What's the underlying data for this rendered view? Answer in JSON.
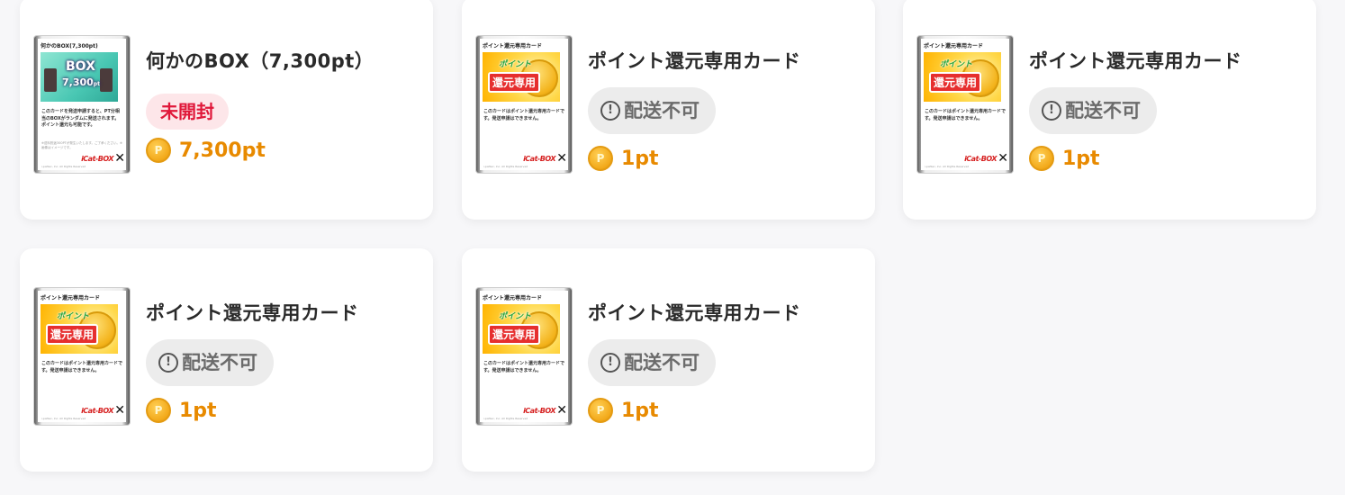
{
  "items": [
    {
      "name": "何かのBOX（7,300pt）",
      "status": "未開封",
      "status_type": "unopened",
      "points": "7,300pt",
      "card": {
        "header": "何かのBOX(7,300pt)",
        "art_line1": "BOX",
        "art_line2": "7,300",
        "art_line2_suffix": "pt",
        "desc": "このカードを発送申請すると、PT分相当のBOXがランダムに発送されます。ポイント還元も可能です。",
        "note": "※送料別途300PTが発生いたします。ご了承ください。※画像はイメージです。",
        "logo": "iCat-BOX",
        "copyright": "i-palSec, Inc. All Rights Reserved"
      }
    },
    {
      "name": "ポイント還元専用カード",
      "status": "配送不可",
      "status_type": "no-delivery",
      "points": "1pt",
      "card": {
        "header": "ポイント還元専用カード",
        "art_line1": "ポイント",
        "art_line2": "還元専用",
        "desc": "このカードはポイント還元専用カードです。発送申請はできません。",
        "logo": "iCat-BOX",
        "copyright": "i-palSec, Inc. All Rights Reserved"
      }
    },
    {
      "name": "ポイント還元専用カード",
      "status": "配送不可",
      "status_type": "no-delivery",
      "points": "1pt",
      "card": {
        "header": "ポイント還元専用カード",
        "art_line1": "ポイント",
        "art_line2": "還元専用",
        "desc": "このカードはポイント還元専用カードです。発送申請はできません。",
        "logo": "iCat-BOX",
        "copyright": "i-palSec, Inc. All Rights Reserved"
      }
    },
    {
      "name": "ポイント還元専用カード",
      "status": "配送不可",
      "status_type": "no-delivery",
      "points": "1pt",
      "card": {
        "header": "ポイント還元専用カード",
        "art_line1": "ポイント",
        "art_line2": "還元専用",
        "desc": "このカードはポイント還元専用カードです。発送申請はできません。",
        "logo": "iCat-BOX",
        "copyright": "i-palSec, Inc. All Rights Reserved"
      }
    },
    {
      "name": "ポイント還元専用カード",
      "status": "配送不可",
      "status_type": "no-delivery",
      "points": "1pt",
      "card": {
        "header": "ポイント還元専用カード",
        "art_line1": "ポイント",
        "art_line2": "還元専用",
        "desc": "このカードはポイント還元専用カードです。発送申請はできません。",
        "logo": "iCat-BOX",
        "copyright": "i-palSec, Inc. All Rights Reserved"
      }
    }
  ],
  "icons": {
    "coin": "coin-icon",
    "coin_glyph": "P",
    "warning": "exclamation-circle-icon",
    "warning_glyph": "!"
  },
  "colors": {
    "unopened_badge_bg": "#fde6e9",
    "unopened_badge_text": "#e0183a",
    "no_delivery_badge_bg": "#ececec",
    "no_delivery_badge_text": "#6b6b6b",
    "points_text": "#e88a00"
  }
}
